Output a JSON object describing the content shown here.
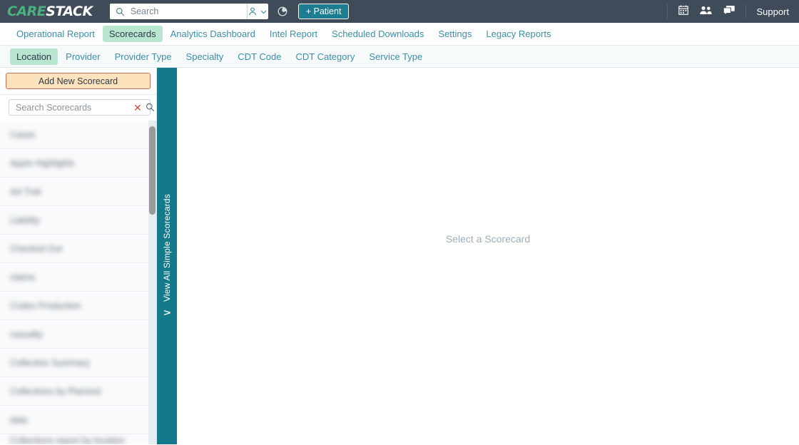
{
  "header": {
    "logo": {
      "part1": "CARE",
      "part2": "STACK"
    },
    "search": {
      "placeholder": "Search",
      "value": "",
      "icon": "search-icon"
    },
    "user_dropdown": {
      "icon": "user-icon",
      "chevron": "chevron-down-icon"
    },
    "history_icon": "clock-history-icon",
    "add_patient_label": "+ Patient",
    "right_icons": [
      {
        "name": "calendar-icon",
        "glyph": "▦"
      },
      {
        "name": "people-icon",
        "glyph": "👥"
      },
      {
        "name": "chat-icon",
        "glyph": "💬"
      }
    ],
    "support_label": "Support"
  },
  "primary_nav": {
    "items": [
      {
        "label": "Operational Report",
        "active": false
      },
      {
        "label": "Scorecards",
        "active": true
      },
      {
        "label": "Analytics Dashboard",
        "active": false
      },
      {
        "label": "Intel Report",
        "active": false
      },
      {
        "label": "Scheduled Downloads",
        "active": false
      },
      {
        "label": "Settings",
        "active": false
      },
      {
        "label": "Legacy Reports",
        "active": false
      }
    ]
  },
  "secondary_nav": {
    "items": [
      {
        "label": "Location",
        "active": true
      },
      {
        "label": "Provider",
        "active": false
      },
      {
        "label": "Provider Type",
        "active": false
      },
      {
        "label": "Specialty",
        "active": false
      },
      {
        "label": "CDT Code",
        "active": false
      },
      {
        "label": "CDT Category",
        "active": false
      },
      {
        "label": "Service Type",
        "active": false
      }
    ]
  },
  "sidebar": {
    "add_button_label": "Add New Scorecard",
    "search": {
      "placeholder": "Search Scorecards",
      "value": "",
      "clear_icon": "clear-x-icon",
      "search_icon": "search-icon"
    },
    "scorecards": [
      {
        "label": "Cases"
      },
      {
        "label": "Appts Highlights"
      },
      {
        "label": "AA Trial"
      },
      {
        "label": "Liability"
      },
      {
        "label": "Checked Out"
      },
      {
        "label": "claims"
      },
      {
        "label": "Codes Production"
      },
      {
        "label": "casualty"
      },
      {
        "label": "Collection Summary"
      },
      {
        "label": "Collections by Planned"
      },
      {
        "label": "data"
      },
      {
        "label": "Collections report by location"
      }
    ]
  },
  "teal_panel": {
    "label": "View All Simple Scorecards",
    "chevron": "chevron-left-icon"
  },
  "main": {
    "placeholder": "Select a Scorecard"
  },
  "colors": {
    "header_bg": "#3f4b58",
    "accent_teal": "#15798c",
    "active_tab": "#b9e6d0",
    "link_blue": "#3c8fa8",
    "add_btn_bg": "#fce3be",
    "add_btn_border": "#c8705a",
    "logo_green": "#49b27f"
  }
}
